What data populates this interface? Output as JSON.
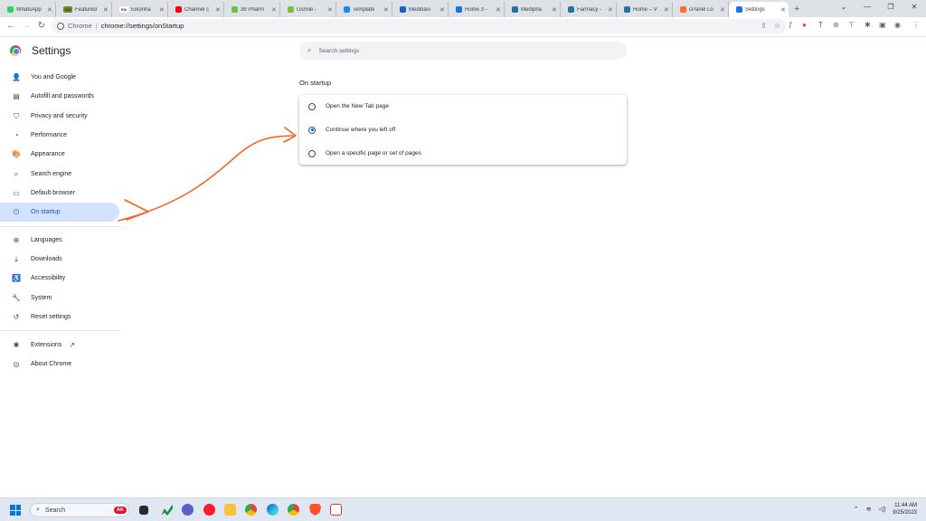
{
  "tabs": [
    {
      "label": "WhatsApp",
      "fav_color": "#25d366",
      "fav_text": ""
    },
    {
      "label": "Featured",
      "fav_color": "#6b8e23",
      "fav_text": "365"
    },
    {
      "label": "Eikonha",
      "fav_color": "#ffffff",
      "fav_text": "Eik"
    },
    {
      "label": "Channel c",
      "fav_color": "#ff0000",
      "fav_text": ""
    },
    {
      "label": "39 Pharm",
      "fav_color": "#6cc24a",
      "fav_text": ""
    },
    {
      "label": "Usmile - ",
      "fav_color": "#7ac143",
      "fav_text": ""
    },
    {
      "label": "Template",
      "fav_color": "#1e88e5",
      "fav_text": ""
    },
    {
      "label": "Medibasi",
      "fav_color": "#1565c0",
      "fav_text": ""
    },
    {
      "label": "Home 3 -",
      "fav_color": "#1976d2",
      "fav_text": ""
    },
    {
      "label": "Medipha",
      "fav_color": "#21759b",
      "fav_text": ""
    },
    {
      "label": "Farmacy -",
      "fav_color": "#21759b",
      "fav_text": ""
    },
    {
      "label": "Home – V",
      "fav_color": "#21759b",
      "fav_text": ""
    },
    {
      "label": "cPanel Lo",
      "fav_color": "#ff6c2c",
      "fav_text": ""
    },
    {
      "label": "Settings",
      "fav_color": "#1a73e8",
      "fav_text": ""
    }
  ],
  "omnibox": {
    "site_label": "Chrome",
    "url": "chrome://settings/onStartup"
  },
  "settings_title": "Settings",
  "sidebar": {
    "items": [
      {
        "label": "You and Google",
        "icon": "person-icon"
      },
      {
        "label": "Autofill and passwords",
        "icon": "clipboard-icon"
      },
      {
        "label": "Privacy and security",
        "icon": "shield-icon"
      },
      {
        "label": "Performance",
        "icon": "speedometer-icon"
      },
      {
        "label": "Appearance",
        "icon": "palette-icon"
      },
      {
        "label": "Search engine",
        "icon": "search-icon"
      },
      {
        "label": "Default browser",
        "icon": "browser-icon"
      },
      {
        "label": "On startup",
        "icon": "power-icon"
      }
    ],
    "items2": [
      {
        "label": "Languages",
        "icon": "globe-icon"
      },
      {
        "label": "Downloads",
        "icon": "download-icon"
      },
      {
        "label": "Accessibility",
        "icon": "accessibility-icon"
      },
      {
        "label": "System",
        "icon": "wrench-icon"
      },
      {
        "label": "Reset settings",
        "icon": "history-icon"
      }
    ],
    "extensions": "Extensions",
    "about": "About Chrome"
  },
  "search": {
    "placeholder": "Search settings"
  },
  "startup": {
    "heading": "On startup",
    "options": [
      {
        "label": "Open the New Tab page",
        "selected": false
      },
      {
        "label": "Continue where you left off",
        "selected": true
      },
      {
        "label": "Open a specific page or set of pages",
        "selected": false
      }
    ]
  },
  "taskbar": {
    "search_label": "Search",
    "badge": "AK",
    "time": "11:44 AM",
    "date": "9/25/2023"
  },
  "colors": {
    "accent": "#0b57d0",
    "selected_bg": "#d3e3fd",
    "annotation": "#f26522"
  }
}
